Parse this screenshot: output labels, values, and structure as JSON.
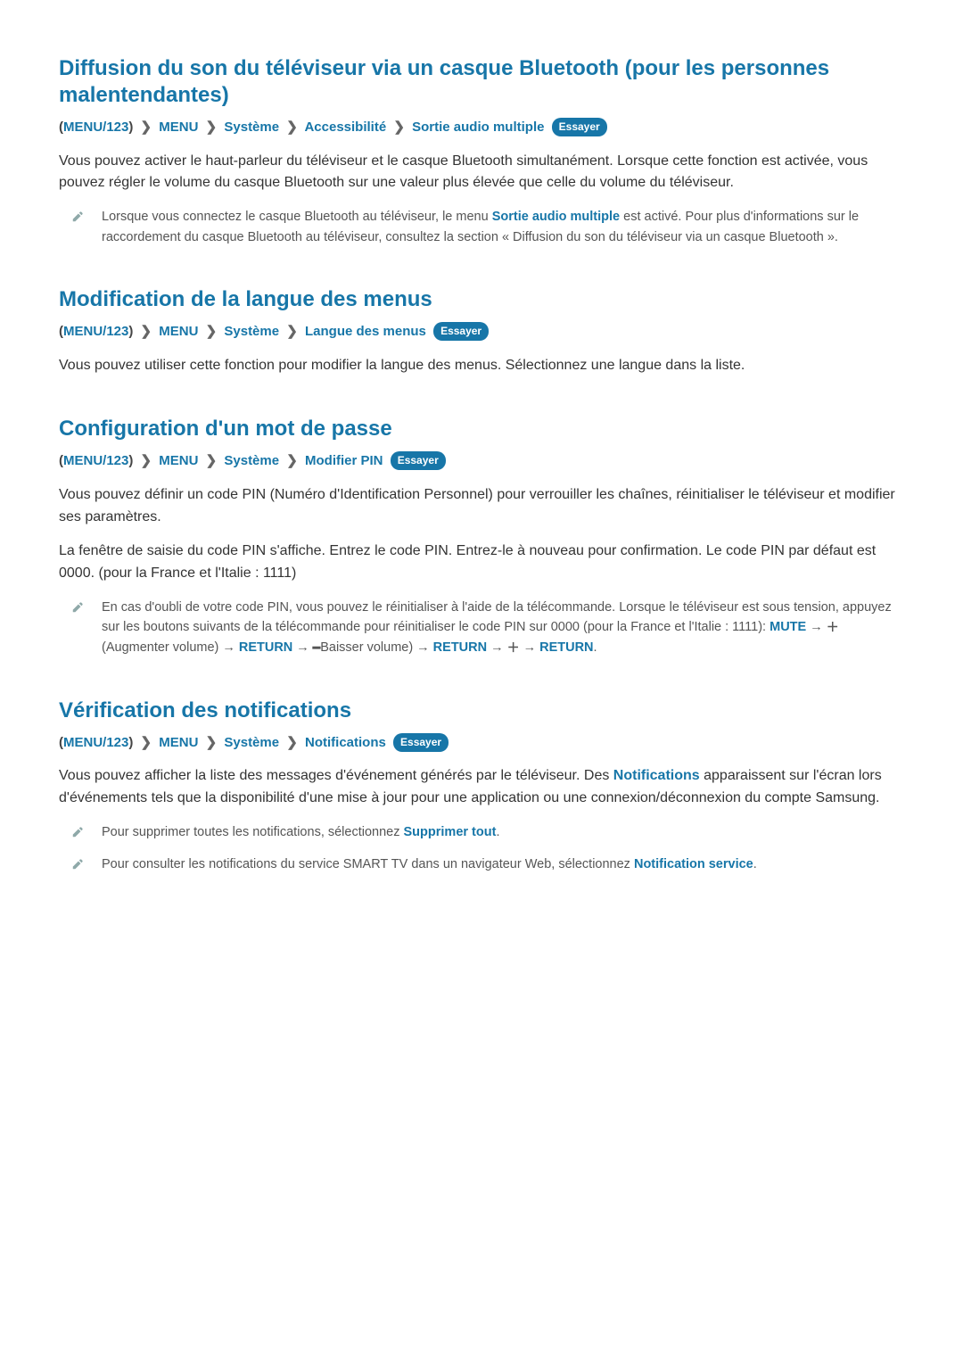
{
  "common": {
    "essayer": "Essayer",
    "menu123": "MENU/123",
    "menu": "MENU",
    "systeme": "Système"
  },
  "s1": {
    "title": "Diffusion du son du téléviseur via un casque Bluetooth (pour les personnes malentendantes)",
    "crumb_accessibilite": "Accessibilité",
    "crumb_sortie": "Sortie audio multiple",
    "p1": "Vous pouvez activer le haut-parleur du téléviseur et le casque Bluetooth simultanément. Lorsque cette fonction est activée, vous pouvez régler le volume du casque Bluetooth sur une valeur plus élevée que celle du volume du téléviseur.",
    "note_pre": "Lorsque vous connectez le casque Bluetooth au téléviseur, le menu ",
    "note_bold": "Sortie audio multiple",
    "note_post": " est activé. Pour plus d'informations sur le raccordement du casque Bluetooth au téléviseur, consultez la section « Diffusion du son du téléviseur via un casque Bluetooth »."
  },
  "s2": {
    "title": "Modification de la langue des menus",
    "crumb_langue": "Langue des menus",
    "p1": "Vous pouvez utiliser cette fonction pour modifier la langue des menus. Sélectionnez une langue dans la liste."
  },
  "s3": {
    "title": "Configuration d'un mot de passe",
    "crumb_pin": "Modifier PIN",
    "p1": "Vous pouvez définir un code PIN (Numéro d'Identification Personnel) pour verrouiller les chaînes, réinitialiser le téléviseur et modifier ses paramètres.",
    "p2": "La fenêtre de saisie du code PIN s'affiche. Entrez le code PIN. Entrez-le à nouveau pour confirmation. Le code PIN par défaut est 0000. (pour la France et l'Italie : 1111)",
    "note_pre": "En cas d'oubli de votre code PIN, vous pouvez le réinitialiser à l'aide de la télécommande. Lorsque le téléviseur est sous tension, appuyez sur les boutons suivants de la télécommande pour réinitialiser le code PIN sur 0000 (pour la France et l'Italie : 1111): ",
    "mute": "MUTE",
    "return": "RETURN",
    "vol_up": "(Augmenter volume)",
    "vol_down": "Baisser volume)"
  },
  "s4": {
    "title": "Vérification des notifications",
    "crumb_notif": "Notifications",
    "p1_pre": "Vous pouvez afficher la liste des messages d'événement générés par le téléviseur. Des ",
    "p1_bold": "Notifications",
    "p1_post": " apparaissent sur l'écran lors d'événements tels que la disponibilité d'une mise à jour pour une application ou une connexion/déconnexion du compte Samsung.",
    "note1_pre": "Pour supprimer toutes les notifications, sélectionnez ",
    "note1_bold": "Supprimer tout",
    "note2_pre": "Pour consulter les notifications du service SMART TV dans un navigateur Web, sélectionnez ",
    "note2_bold": "Notification service"
  }
}
